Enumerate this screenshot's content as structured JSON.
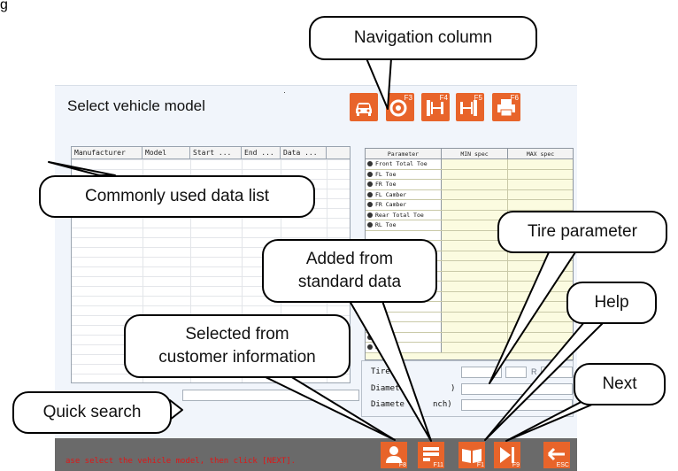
{
  "top_fragment": "g",
  "window": {
    "title": "Select vehicle model",
    "dot": "·"
  },
  "nav_buttons": [
    {
      "icon": "car-icon",
      "fkey": ""
    },
    {
      "icon": "wheel-icon",
      "fkey": "F3"
    },
    {
      "icon": "toe-gauge-icon",
      "fkey": "F4"
    },
    {
      "icon": "camber-gauge-icon",
      "fkey": "F5"
    },
    {
      "icon": "printer-icon",
      "fkey": "F6"
    }
  ],
  "data_list": {
    "columns": [
      "Manufacturer",
      "Model",
      "Start ...",
      "End ...",
      "Data ..."
    ]
  },
  "parameter_table": {
    "columns": [
      "Parameter",
      "MIN spec",
      "MAX spec"
    ],
    "rows": [
      "Front Total Toe",
      "FL Toe",
      "FR Toe",
      "FL Camber",
      "FR Camber",
      "Rear Total Toe",
      "RL Toe",
      "",
      "",
      "",
      "",
      "",
      "",
      "",
      "",
      "Ri",
      "Whe",
      "Fron",
      "Rear"
    ]
  },
  "tire": {
    "tire_label": "Tire",
    "diameter_label_1": "Diamete",
    "diameter_unit_1": ")",
    "diameter_label_2": "Diamete",
    "diameter_unit_2": "nch)",
    "r_label": "R"
  },
  "status_text": "ase select the vehicle model, then click [NEXT].",
  "bottom_buttons": [
    {
      "icon": "customer-icon",
      "fkey": "F8"
    },
    {
      "icon": "standard-data-icon",
      "fkey": "F11"
    },
    {
      "icon": "help-book-icon",
      "fkey": "F1"
    },
    {
      "icon": "next-icon",
      "fkey": "F9"
    },
    {
      "icon": "back-arrow-icon",
      "fkey": "ESC"
    }
  ],
  "callouts": {
    "navigation": "Navigation column",
    "data_list": "Commonly used data list",
    "tire_parameter": "Tire parameter",
    "standard_data_1": "Added from",
    "standard_data_2": "standard data",
    "help": "Help",
    "customer_1": "Selected from",
    "customer_2": "customer information",
    "next": "Next",
    "quick_search": "Quick search"
  },
  "colors": {
    "accent": "#e8642a",
    "status_text": "#e01616",
    "bar": "#6a6a6a",
    "param_bg": "#fbfbe0",
    "window_bg": "#f1f5fb"
  }
}
